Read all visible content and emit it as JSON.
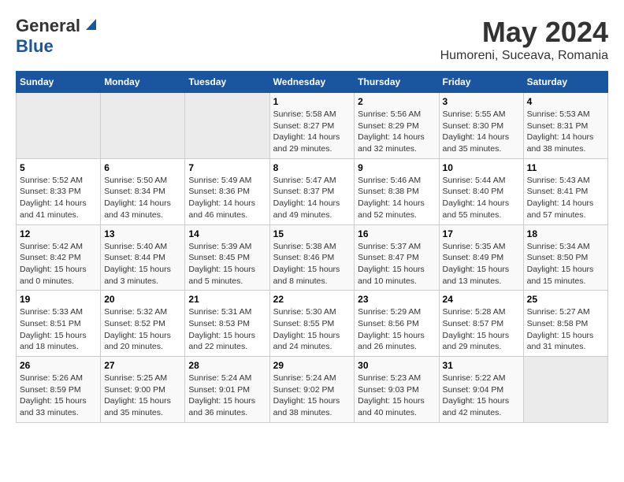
{
  "header": {
    "logo_general": "General",
    "logo_blue": "Blue",
    "month_title": "May 2024",
    "location": "Humoreni, Suceava, Romania"
  },
  "weekdays": [
    "Sunday",
    "Monday",
    "Tuesday",
    "Wednesday",
    "Thursday",
    "Friday",
    "Saturday"
  ],
  "weeks": [
    [
      {
        "day": "",
        "info": ""
      },
      {
        "day": "",
        "info": ""
      },
      {
        "day": "",
        "info": ""
      },
      {
        "day": "1",
        "info": "Sunrise: 5:58 AM\nSunset: 8:27 PM\nDaylight: 14 hours\nand 29 minutes."
      },
      {
        "day": "2",
        "info": "Sunrise: 5:56 AM\nSunset: 8:29 PM\nDaylight: 14 hours\nand 32 minutes."
      },
      {
        "day": "3",
        "info": "Sunrise: 5:55 AM\nSunset: 8:30 PM\nDaylight: 14 hours\nand 35 minutes."
      },
      {
        "day": "4",
        "info": "Sunrise: 5:53 AM\nSunset: 8:31 PM\nDaylight: 14 hours\nand 38 minutes."
      }
    ],
    [
      {
        "day": "5",
        "info": "Sunrise: 5:52 AM\nSunset: 8:33 PM\nDaylight: 14 hours\nand 41 minutes."
      },
      {
        "day": "6",
        "info": "Sunrise: 5:50 AM\nSunset: 8:34 PM\nDaylight: 14 hours\nand 43 minutes."
      },
      {
        "day": "7",
        "info": "Sunrise: 5:49 AM\nSunset: 8:36 PM\nDaylight: 14 hours\nand 46 minutes."
      },
      {
        "day": "8",
        "info": "Sunrise: 5:47 AM\nSunset: 8:37 PM\nDaylight: 14 hours\nand 49 minutes."
      },
      {
        "day": "9",
        "info": "Sunrise: 5:46 AM\nSunset: 8:38 PM\nDaylight: 14 hours\nand 52 minutes."
      },
      {
        "day": "10",
        "info": "Sunrise: 5:44 AM\nSunset: 8:40 PM\nDaylight: 14 hours\nand 55 minutes."
      },
      {
        "day": "11",
        "info": "Sunrise: 5:43 AM\nSunset: 8:41 PM\nDaylight: 14 hours\nand 57 minutes."
      }
    ],
    [
      {
        "day": "12",
        "info": "Sunrise: 5:42 AM\nSunset: 8:42 PM\nDaylight: 15 hours\nand 0 minutes."
      },
      {
        "day": "13",
        "info": "Sunrise: 5:40 AM\nSunset: 8:44 PM\nDaylight: 15 hours\nand 3 minutes."
      },
      {
        "day": "14",
        "info": "Sunrise: 5:39 AM\nSunset: 8:45 PM\nDaylight: 15 hours\nand 5 minutes."
      },
      {
        "day": "15",
        "info": "Sunrise: 5:38 AM\nSunset: 8:46 PM\nDaylight: 15 hours\nand 8 minutes."
      },
      {
        "day": "16",
        "info": "Sunrise: 5:37 AM\nSunset: 8:47 PM\nDaylight: 15 hours\nand 10 minutes."
      },
      {
        "day": "17",
        "info": "Sunrise: 5:35 AM\nSunset: 8:49 PM\nDaylight: 15 hours\nand 13 minutes."
      },
      {
        "day": "18",
        "info": "Sunrise: 5:34 AM\nSunset: 8:50 PM\nDaylight: 15 hours\nand 15 minutes."
      }
    ],
    [
      {
        "day": "19",
        "info": "Sunrise: 5:33 AM\nSunset: 8:51 PM\nDaylight: 15 hours\nand 18 minutes."
      },
      {
        "day": "20",
        "info": "Sunrise: 5:32 AM\nSunset: 8:52 PM\nDaylight: 15 hours\nand 20 minutes."
      },
      {
        "day": "21",
        "info": "Sunrise: 5:31 AM\nSunset: 8:53 PM\nDaylight: 15 hours\nand 22 minutes."
      },
      {
        "day": "22",
        "info": "Sunrise: 5:30 AM\nSunset: 8:55 PM\nDaylight: 15 hours\nand 24 minutes."
      },
      {
        "day": "23",
        "info": "Sunrise: 5:29 AM\nSunset: 8:56 PM\nDaylight: 15 hours\nand 26 minutes."
      },
      {
        "day": "24",
        "info": "Sunrise: 5:28 AM\nSunset: 8:57 PM\nDaylight: 15 hours\nand 29 minutes."
      },
      {
        "day": "25",
        "info": "Sunrise: 5:27 AM\nSunset: 8:58 PM\nDaylight: 15 hours\nand 31 minutes."
      }
    ],
    [
      {
        "day": "26",
        "info": "Sunrise: 5:26 AM\nSunset: 8:59 PM\nDaylight: 15 hours\nand 33 minutes."
      },
      {
        "day": "27",
        "info": "Sunrise: 5:25 AM\nSunset: 9:00 PM\nDaylight: 15 hours\nand 35 minutes."
      },
      {
        "day": "28",
        "info": "Sunrise: 5:24 AM\nSunset: 9:01 PM\nDaylight: 15 hours\nand 36 minutes."
      },
      {
        "day": "29",
        "info": "Sunrise: 5:24 AM\nSunset: 9:02 PM\nDaylight: 15 hours\nand 38 minutes."
      },
      {
        "day": "30",
        "info": "Sunrise: 5:23 AM\nSunset: 9:03 PM\nDaylight: 15 hours\nand 40 minutes."
      },
      {
        "day": "31",
        "info": "Sunrise: 5:22 AM\nSunset: 9:04 PM\nDaylight: 15 hours\nand 42 minutes."
      },
      {
        "day": "",
        "info": ""
      }
    ]
  ]
}
